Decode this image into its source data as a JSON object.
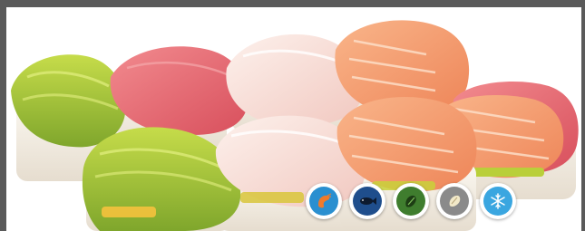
{
  "photo": {
    "subject": "sushi-rolls"
  },
  "badges": [
    {
      "icon": "shrimp-icon",
      "color": "#2a8fd0"
    },
    {
      "icon": "fish-icon",
      "color": "#1f4e8c"
    },
    {
      "icon": "vegetable-icon",
      "color": "#3f7d2e"
    },
    {
      "icon": "shell-icon",
      "color": "#8a8a8a"
    },
    {
      "icon": "snowflake-icon",
      "color": "#3aa6e0"
    }
  ],
  "colors": {
    "frame": "#5a5a5a",
    "avocado": "#9bc23c",
    "tuna": "#e9606a",
    "whitefish": "#f6d9d4",
    "salmon": "#f49a6c",
    "rice": "#f7f3ea"
  }
}
